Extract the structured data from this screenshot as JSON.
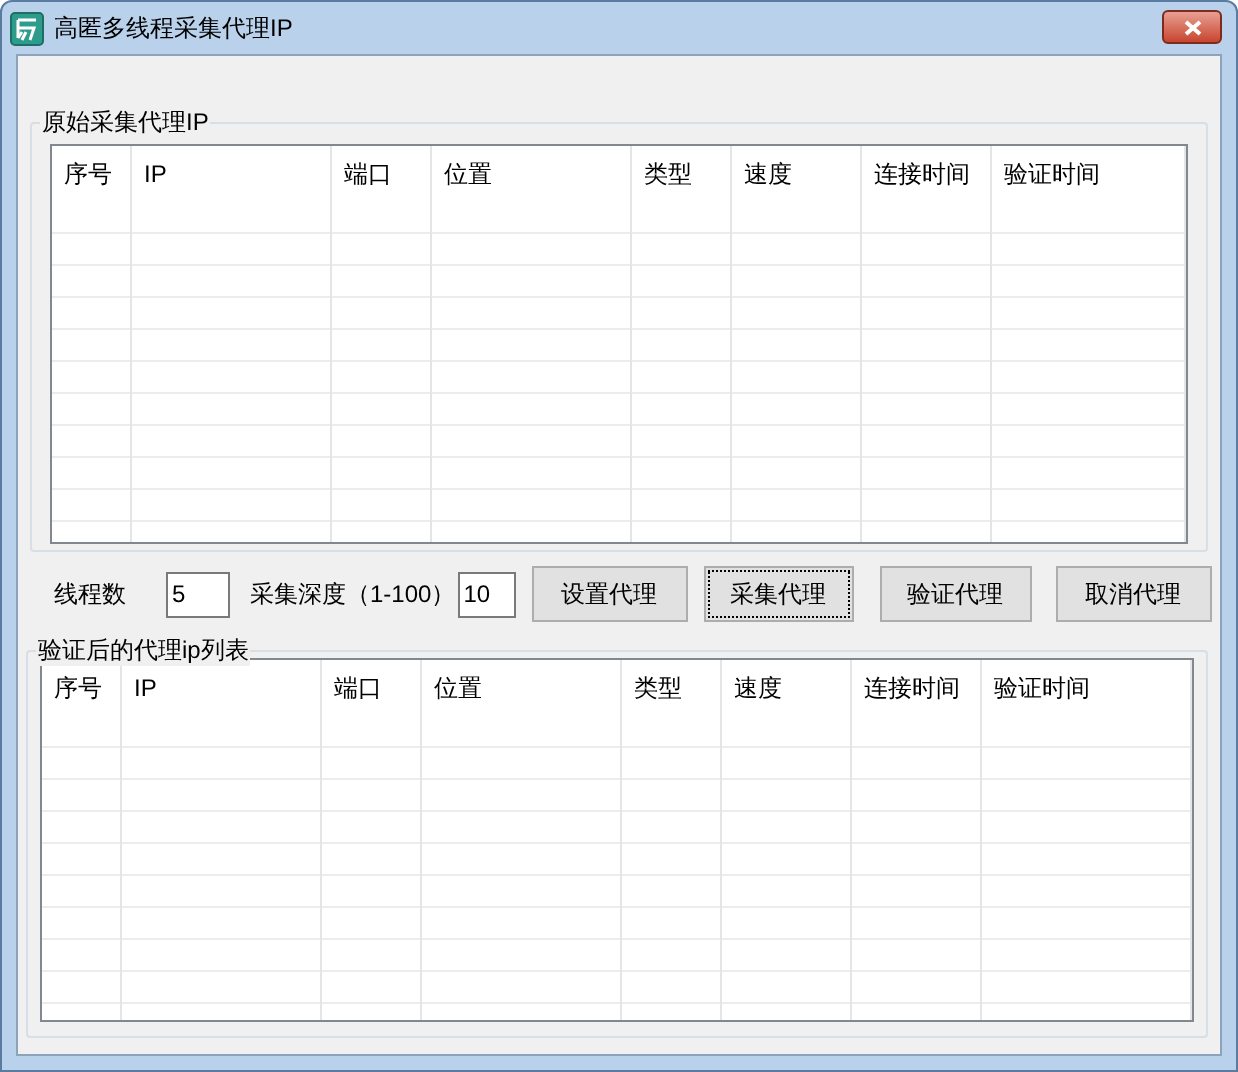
{
  "window": {
    "title": "高匿多线程采集代理IP"
  },
  "groups": [
    {
      "title": "原始采集代理IP",
      "columns": [
        "序号",
        "IP",
        "端口",
        "位置",
        "类型",
        "速度",
        "连接时间",
        "验证时间"
      ]
    },
    {
      "title": "验证后的代理ip列表",
      "columns": [
        "序号",
        "IP",
        "端口",
        "位置",
        "类型",
        "速度",
        "连接时间",
        "验证时间"
      ]
    }
  ],
  "controls": {
    "threads_label": "线程数",
    "threads_value": "5",
    "depth_label": "采集深度（1-100）",
    "depth_value": "10",
    "buttons": [
      {
        "label": "设置代理",
        "focused": false
      },
      {
        "label": "采集代理",
        "focused": true
      },
      {
        "label": "验证代理",
        "focused": false
      },
      {
        "label": "取消代理",
        "focused": false
      }
    ]
  }
}
